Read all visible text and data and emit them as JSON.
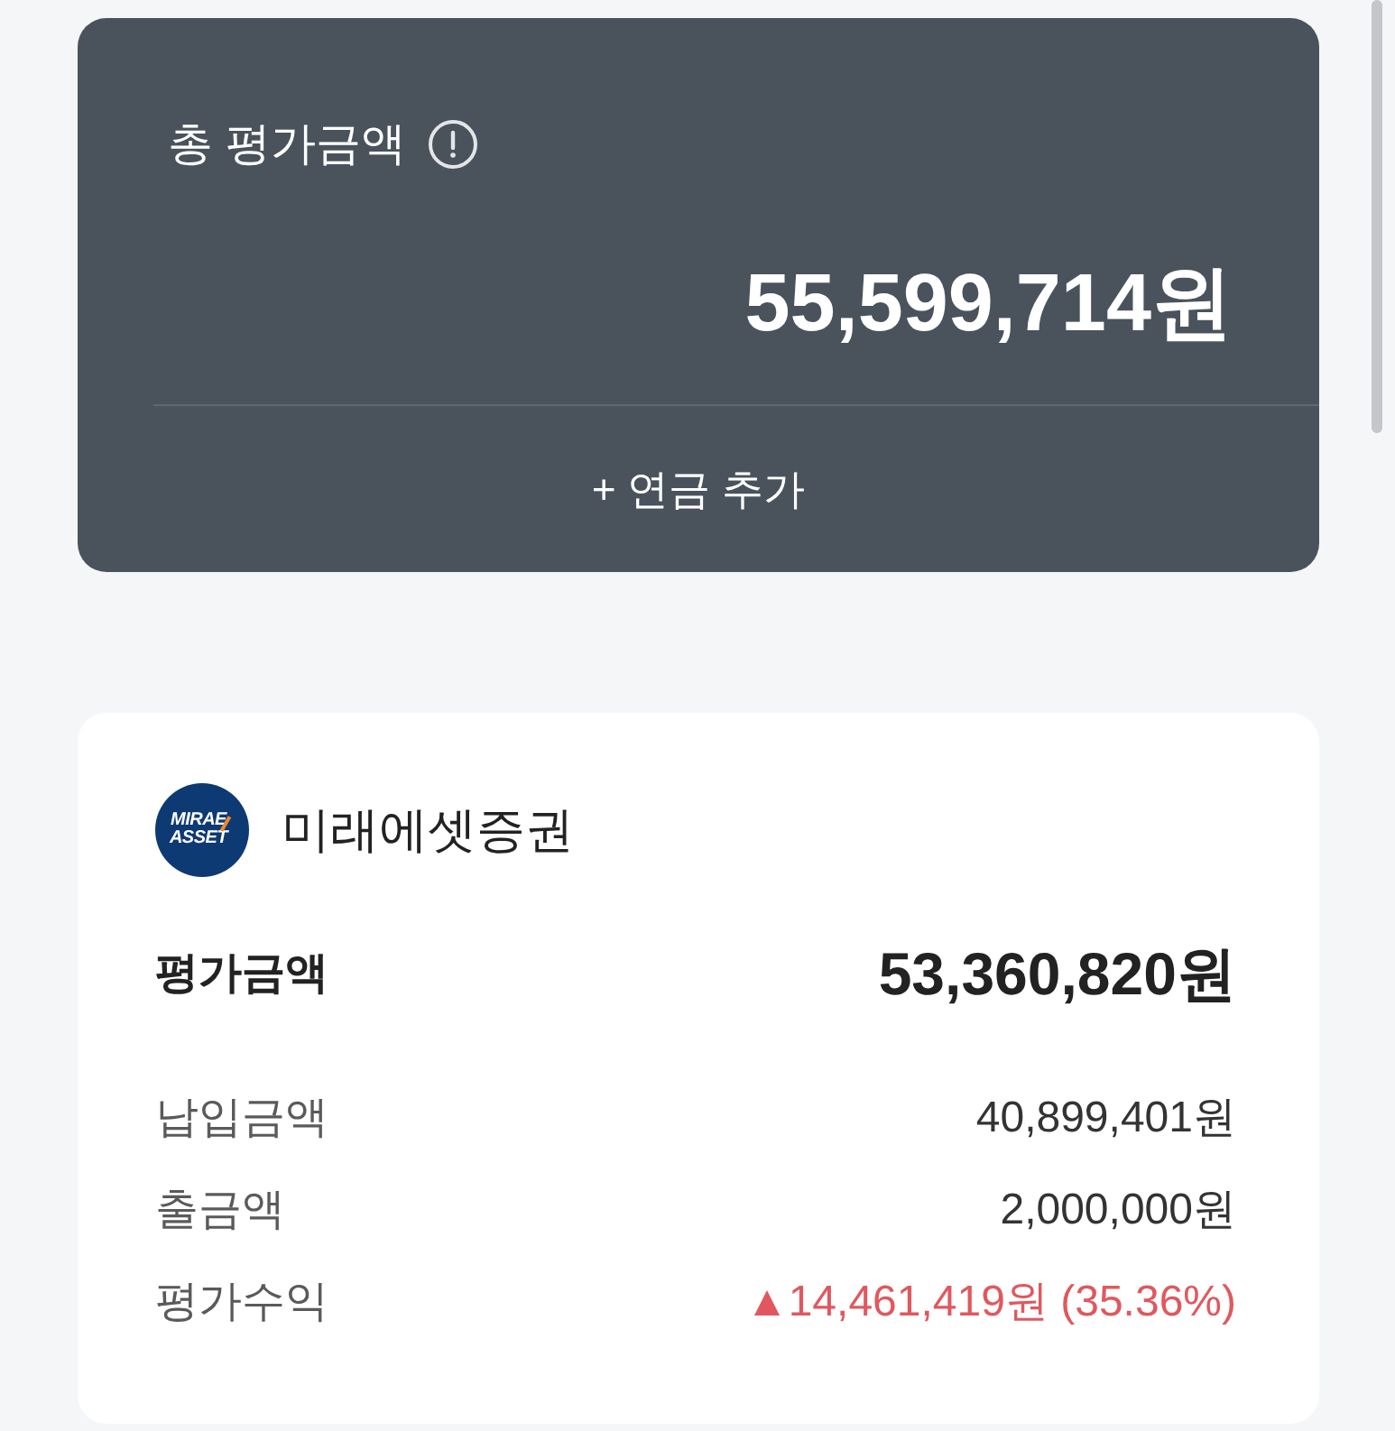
{
  "summary": {
    "title": "총 평가금액",
    "total": "55,599,714원",
    "add_button": "+ 연금 추가"
  },
  "accounts": [
    {
      "logo_text": "MIRAE ASSET",
      "name": "미래에셋증권",
      "rows": [
        {
          "kind": "headline",
          "label": "평가금액",
          "value": "53,360,820원"
        },
        {
          "kind": "detail",
          "label": "납입금액",
          "value": "40,899,401원"
        },
        {
          "kind": "detail",
          "label": "출금액",
          "value": "2,000,000원"
        },
        {
          "kind": "gain",
          "label": "평가수익",
          "value": "▲14,461,419원 (35.36%)"
        }
      ]
    }
  ]
}
